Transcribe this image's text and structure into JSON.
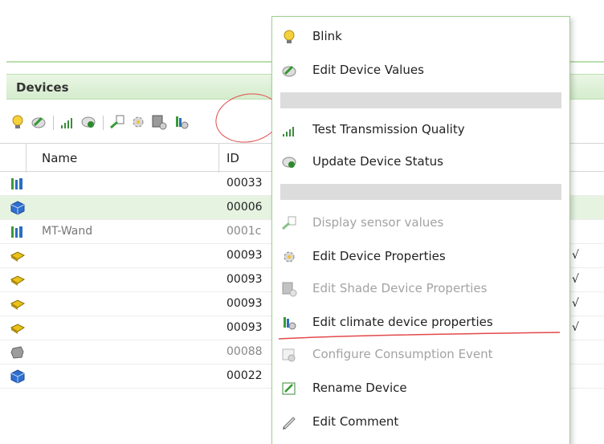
{
  "devices_panel": {
    "title": "Devices",
    "columns": {
      "name": "Name",
      "id": "ID"
    },
    "rows": [
      {
        "icon": "climate-device-icon",
        "name": "",
        "id": "00033",
        "selected": false,
        "greyed": false,
        "check": ""
      },
      {
        "icon": "blue-cube-icon",
        "name": "",
        "id": "00006",
        "selected": true,
        "greyed": false,
        "check": ""
      },
      {
        "icon": "climate-device-icon",
        "name": "MT-Wand",
        "id": "0001c",
        "selected": false,
        "greyed": true,
        "check": ""
      },
      {
        "icon": "yellow-actuator-icon",
        "name": "",
        "id": "00093",
        "selected": false,
        "greyed": false,
        "check": "√"
      },
      {
        "icon": "yellow-actuator-icon",
        "name": "",
        "id": "00093",
        "selected": false,
        "greyed": false,
        "check": "√"
      },
      {
        "icon": "yellow-actuator-icon",
        "name": "",
        "id": "00093",
        "selected": false,
        "greyed": false,
        "check": "√"
      },
      {
        "icon": "yellow-actuator-icon",
        "name": "",
        "id": "00093",
        "selected": false,
        "greyed": false,
        "check": "√"
      },
      {
        "icon": "grey-device-icon",
        "name": "",
        "id": "00088",
        "selected": false,
        "greyed": true,
        "check": ""
      },
      {
        "icon": "blue-cube-icon",
        "name": "",
        "id": "00022",
        "selected": false,
        "greyed": false,
        "check": ""
      }
    ]
  },
  "toolbar": {
    "icons": [
      "blink-icon",
      "edit-values-icon",
      "transmission-quality-icon",
      "update-status-icon",
      "sensor-values-icon",
      "device-properties-icon",
      "shade-properties-icon",
      "climate-properties-icon"
    ]
  },
  "context_menu": {
    "items": [
      {
        "label": "Blink",
        "icon": "lightbulb-icon",
        "enabled": true
      },
      {
        "label": "Edit Device Values",
        "icon": "edit-values-icon",
        "enabled": true
      },
      {
        "separator": true
      },
      {
        "label": "Test Transmission Quality",
        "icon": "signal-bars-icon",
        "enabled": true
      },
      {
        "label": "Update Device Status",
        "icon": "refresh-status-icon",
        "enabled": true
      },
      {
        "separator": true
      },
      {
        "label": "Display sensor values",
        "icon": "sensor-values-icon",
        "enabled": false
      },
      {
        "label": "Edit Device Properties",
        "icon": "gear-icon",
        "enabled": true
      },
      {
        "label": "Edit Shade Device Properties",
        "icon": "shade-gear-icon",
        "enabled": false
      },
      {
        "label": "Edit climate device properties",
        "icon": "climate-gear-icon",
        "enabled": true
      },
      {
        "label": "Configure Consumption Event",
        "icon": "consumption-event-icon",
        "enabled": false
      },
      {
        "label": "Rename Device",
        "icon": "rename-icon",
        "enabled": true
      },
      {
        "label": "Edit Comment",
        "icon": "comment-pen-icon",
        "enabled": true
      }
    ]
  },
  "colors": {
    "accent_green": "#9fd08f",
    "selected_row": "#e5f3e0",
    "annotation_red": "#e24a4a",
    "disabled_text": "#a3a3a3"
  }
}
